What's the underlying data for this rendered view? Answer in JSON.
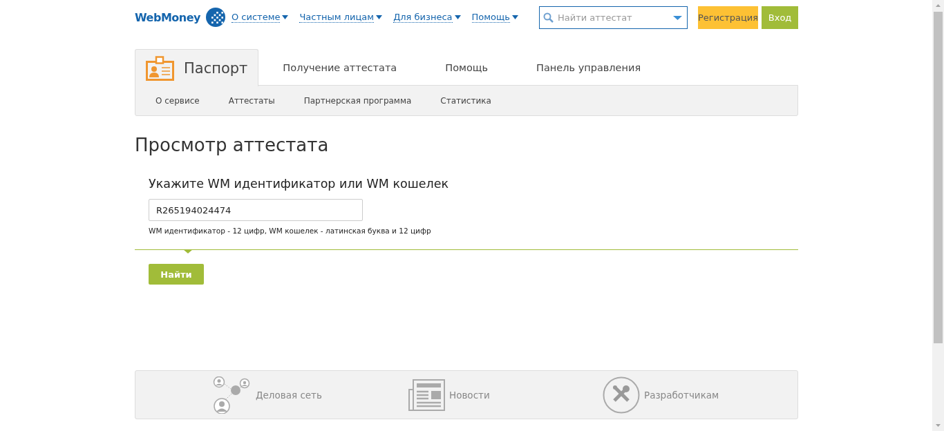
{
  "header": {
    "logo": "WebMoney",
    "menu": [
      {
        "label": "О системе"
      },
      {
        "label": "Частным лицам"
      },
      {
        "label": "Для бизнеса"
      },
      {
        "label": "Помощь"
      }
    ],
    "search": {
      "placeholder": "Найти аттестат"
    },
    "buttons": [
      {
        "label": "Регистрация",
        "kind": "register"
      },
      {
        "label": "Вход",
        "kind": "login"
      }
    ]
  },
  "tabs": [
    {
      "label": "Паспорт",
      "selected": true,
      "kind": "logo"
    },
    {
      "label": "Получение аттестата",
      "selected": false,
      "kind": "text"
    },
    {
      "label": "Помощь",
      "selected": false,
      "kind": "text"
    },
    {
      "label": "Панель управления",
      "selected": false,
      "kind": "text"
    }
  ],
  "subnav": [
    {
      "label": "О сервисе"
    },
    {
      "label": "Аттестаты"
    },
    {
      "label": "Партнерская программа"
    },
    {
      "label": "Статистика"
    }
  ],
  "page_title": "Просмотр аттестата",
  "form": {
    "label": "Укажите WM идентификатор или WM кошелек",
    "value": "R265194024474",
    "hint": "WM идентификатор - 12 цифр, WM кошелек - латинская буква и 12 цифр",
    "button": "Найти"
  },
  "footer": [
    {
      "label": "Деловая сеть",
      "kind": "network"
    },
    {
      "label": "Новости",
      "kind": "news"
    },
    {
      "label": "Разработчикам",
      "kind": "tools"
    }
  ]
}
